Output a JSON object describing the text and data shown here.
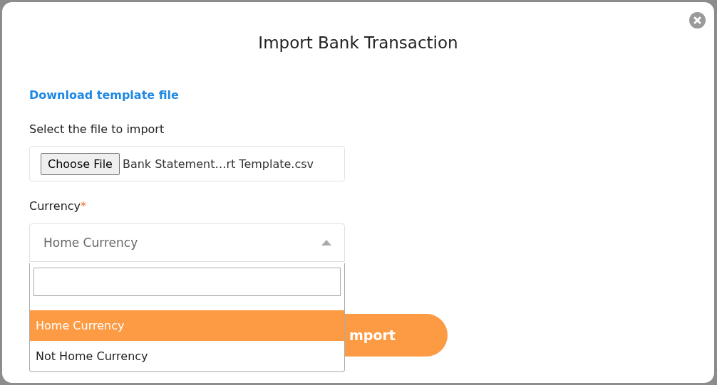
{
  "dialog": {
    "title": "Import Bank Transaction",
    "download_link": "Download template file",
    "file_label": "Select the file to import",
    "file_button": "Choose File",
    "file_name": "Bank Statement…rt Template.csv",
    "currency_label": "Currency",
    "required_mark": "*",
    "currency_value": "Home Currency",
    "dropdown": {
      "expanded": true,
      "options": [
        {
          "label": "Home Currency",
          "selected": true
        },
        {
          "label": "Not Home Currency",
          "selected": false
        }
      ]
    },
    "import_button": "mport"
  }
}
